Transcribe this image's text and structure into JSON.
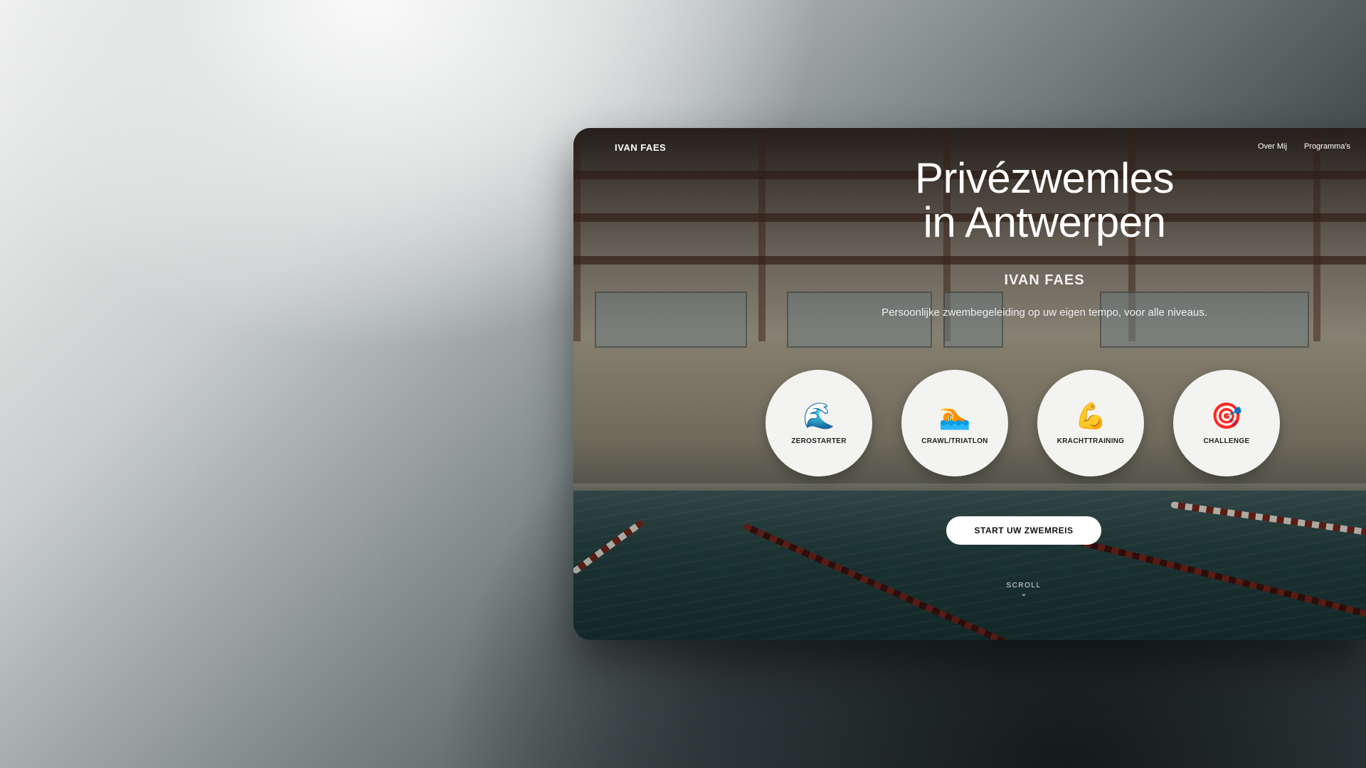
{
  "header": {
    "brand": "IVAN FAES",
    "nav": [
      {
        "label": "Over Mij"
      },
      {
        "label": "Programma's"
      }
    ]
  },
  "hero": {
    "title_line1": "Privézwemles",
    "title_line2": "in Antwerpen",
    "name": "IVAN FAES",
    "subtitle": "Persoonlijke zwembegeleiding op uw eigen tempo, voor alle niveaus."
  },
  "programs": [
    {
      "icon": "🌊",
      "icon_name": "wave-icon",
      "label": "ZEROSTARTER"
    },
    {
      "icon": "🏊",
      "icon_name": "swimmer-icon",
      "label": "CRAWL/TRIATLON"
    },
    {
      "icon": "💪",
      "icon_name": "flexed-biceps-icon",
      "label": "KRACHTTRAINING"
    },
    {
      "icon": "🎯",
      "icon_name": "target-icon",
      "label": "CHALLENGE"
    }
  ],
  "cta": {
    "label": "START UW ZWEMREIS"
  },
  "scroll": {
    "label": "SCROLL",
    "icon": "⌄"
  },
  "colors": {
    "card_bg": "#f3f3f1",
    "cta_bg": "#ffffff",
    "water": "#23403f"
  }
}
